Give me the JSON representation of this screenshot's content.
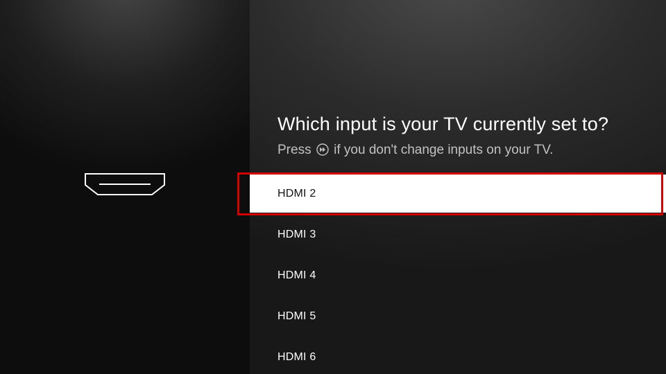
{
  "heading": "Which input is your TV currently set to?",
  "sub_prefix": "Press ",
  "sub_suffix": " if you don't change inputs on your TV.",
  "items": [
    {
      "label": "HDMI 2",
      "selected": true
    },
    {
      "label": "HDMI 3",
      "selected": false
    },
    {
      "label": "HDMI 4",
      "selected": false
    },
    {
      "label": "HDMI 5",
      "selected": false
    },
    {
      "label": "HDMI 6",
      "selected": false
    }
  ]
}
